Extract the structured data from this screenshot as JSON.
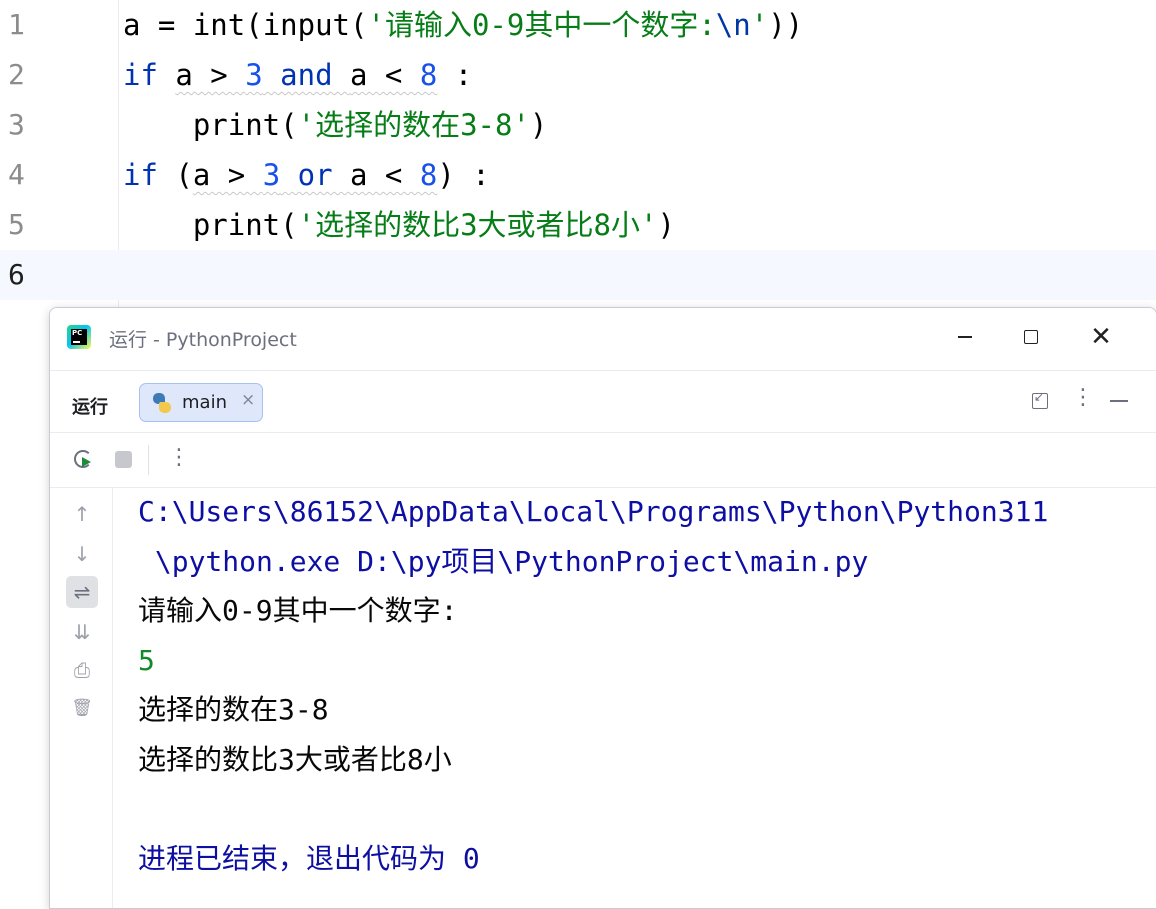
{
  "editor": {
    "line_numbers": [
      "1",
      "2",
      "3",
      "4",
      "5",
      "6"
    ],
    "lines": [
      [
        {
          "t": "a = ",
          "c": "fn"
        },
        {
          "t": "int",
          "c": "fn"
        },
        {
          "t": "(",
          "c": "fn"
        },
        {
          "t": "input",
          "c": "fn"
        },
        {
          "t": "(",
          "c": "fn"
        },
        {
          "t": "'请输入0-9其中一个数字:",
          "c": "str"
        },
        {
          "t": "\\n",
          "c": "esc"
        },
        {
          "t": "'",
          "c": "str"
        },
        {
          "t": "))",
          "c": "fn"
        }
      ],
      [
        {
          "t": "if",
          "c": "kw"
        },
        {
          "t": " ",
          "c": "fn"
        },
        {
          "t": "a > ",
          "c": "fn warn"
        },
        {
          "t": "3",
          "c": "num warn"
        },
        {
          "t": " and ",
          "c": "kw warn"
        },
        {
          "t": "a < ",
          "c": "fn warn"
        },
        {
          "t": "8",
          "c": "num warn"
        },
        {
          "t": " :",
          "c": "fn"
        }
      ],
      [
        {
          "t": "    print",
          "c": "fn"
        },
        {
          "t": "(",
          "c": "fn"
        },
        {
          "t": "'选择的数在3-8'",
          "c": "str"
        },
        {
          "t": ")",
          "c": "fn"
        }
      ],
      [
        {
          "t": "if",
          "c": "kw"
        },
        {
          "t": " (",
          "c": "fn"
        },
        {
          "t": "a > ",
          "c": "fn warn"
        },
        {
          "t": "3",
          "c": "num warn"
        },
        {
          "t": " or ",
          "c": "kw warn"
        },
        {
          "t": "a < ",
          "c": "fn warn"
        },
        {
          "t": "8",
          "c": "num warn"
        },
        {
          "t": ") :",
          "c": "fn"
        }
      ],
      [
        {
          "t": "    print",
          "c": "fn"
        },
        {
          "t": "(",
          "c": "fn"
        },
        {
          "t": "'选择的数比3大或者比8小'",
          "c": "str"
        },
        {
          "t": ")",
          "c": "fn"
        }
      ],
      []
    ]
  },
  "run_window": {
    "title": "运行 - PythonProject",
    "close_symbol": "✕",
    "run_label": "运行",
    "tab_label": "main",
    "tab_close_symbol": "×",
    "more_symbol": "⋮",
    "side_icons": {
      "up": "↑",
      "down": "↓",
      "wrap": "⇌",
      "scroll_end": "⇊",
      "print": "⎙",
      "trash": "🗑"
    },
    "console_lines": [
      {
        "text": "C:\\Users\\86152\\AppData\\Local\\Programs\\Python\\Python311",
        "kind": "c-path"
      },
      {
        "text": " \\python.exe D:\\py项目\\PythonProject\\main.py",
        "kind": "c-path"
      },
      {
        "text": "请输入0-9其中一个数字:",
        "kind": "c-out"
      },
      {
        "text": "5",
        "kind": "c-in"
      },
      {
        "text": "选择的数在3-8",
        "kind": "c-out"
      },
      {
        "text": "选择的数比3大或者比8小",
        "kind": "c-out"
      },
      {
        "text": "",
        "kind": "c-out"
      },
      {
        "text": "进程已结束，退出代码为 0",
        "kind": "c-exit"
      }
    ]
  },
  "colors": {
    "keyword": "#0033b3",
    "number": "#1750eb",
    "string": "#067d17",
    "console_path": "#0d0ea2",
    "console_input": "#118a29",
    "tab_selected_bg": "#dfe7fb"
  }
}
